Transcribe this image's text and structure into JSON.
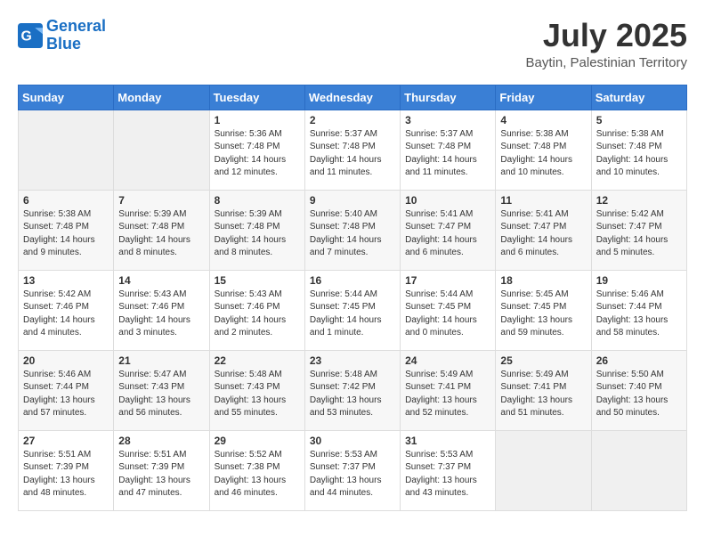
{
  "header": {
    "logo_line1": "General",
    "logo_line2": "Blue",
    "month_year": "July 2025",
    "location": "Baytin, Palestinian Territory"
  },
  "weekdays": [
    "Sunday",
    "Monday",
    "Tuesday",
    "Wednesday",
    "Thursday",
    "Friday",
    "Saturday"
  ],
  "weeks": [
    [
      {
        "day": "",
        "sunrise": "",
        "sunset": "",
        "daylight": ""
      },
      {
        "day": "",
        "sunrise": "",
        "sunset": "",
        "daylight": ""
      },
      {
        "day": "1",
        "sunrise": "Sunrise: 5:36 AM",
        "sunset": "Sunset: 7:48 PM",
        "daylight": "Daylight: 14 hours and 12 minutes."
      },
      {
        "day": "2",
        "sunrise": "Sunrise: 5:37 AM",
        "sunset": "Sunset: 7:48 PM",
        "daylight": "Daylight: 14 hours and 11 minutes."
      },
      {
        "day": "3",
        "sunrise": "Sunrise: 5:37 AM",
        "sunset": "Sunset: 7:48 PM",
        "daylight": "Daylight: 14 hours and 11 minutes."
      },
      {
        "day": "4",
        "sunrise": "Sunrise: 5:38 AM",
        "sunset": "Sunset: 7:48 PM",
        "daylight": "Daylight: 14 hours and 10 minutes."
      },
      {
        "day": "5",
        "sunrise": "Sunrise: 5:38 AM",
        "sunset": "Sunset: 7:48 PM",
        "daylight": "Daylight: 14 hours and 10 minutes."
      }
    ],
    [
      {
        "day": "6",
        "sunrise": "Sunrise: 5:38 AM",
        "sunset": "Sunset: 7:48 PM",
        "daylight": "Daylight: 14 hours and 9 minutes."
      },
      {
        "day": "7",
        "sunrise": "Sunrise: 5:39 AM",
        "sunset": "Sunset: 7:48 PM",
        "daylight": "Daylight: 14 hours and 8 minutes."
      },
      {
        "day": "8",
        "sunrise": "Sunrise: 5:39 AM",
        "sunset": "Sunset: 7:48 PM",
        "daylight": "Daylight: 14 hours and 8 minutes."
      },
      {
        "day": "9",
        "sunrise": "Sunrise: 5:40 AM",
        "sunset": "Sunset: 7:48 PM",
        "daylight": "Daylight: 14 hours and 7 minutes."
      },
      {
        "day": "10",
        "sunrise": "Sunrise: 5:41 AM",
        "sunset": "Sunset: 7:47 PM",
        "daylight": "Daylight: 14 hours and 6 minutes."
      },
      {
        "day": "11",
        "sunrise": "Sunrise: 5:41 AM",
        "sunset": "Sunset: 7:47 PM",
        "daylight": "Daylight: 14 hours and 6 minutes."
      },
      {
        "day": "12",
        "sunrise": "Sunrise: 5:42 AM",
        "sunset": "Sunset: 7:47 PM",
        "daylight": "Daylight: 14 hours and 5 minutes."
      }
    ],
    [
      {
        "day": "13",
        "sunrise": "Sunrise: 5:42 AM",
        "sunset": "Sunset: 7:46 PM",
        "daylight": "Daylight: 14 hours and 4 minutes."
      },
      {
        "day": "14",
        "sunrise": "Sunrise: 5:43 AM",
        "sunset": "Sunset: 7:46 PM",
        "daylight": "Daylight: 14 hours and 3 minutes."
      },
      {
        "day": "15",
        "sunrise": "Sunrise: 5:43 AM",
        "sunset": "Sunset: 7:46 PM",
        "daylight": "Daylight: 14 hours and 2 minutes."
      },
      {
        "day": "16",
        "sunrise": "Sunrise: 5:44 AM",
        "sunset": "Sunset: 7:45 PM",
        "daylight": "Daylight: 14 hours and 1 minute."
      },
      {
        "day": "17",
        "sunrise": "Sunrise: 5:44 AM",
        "sunset": "Sunset: 7:45 PM",
        "daylight": "Daylight: 14 hours and 0 minutes."
      },
      {
        "day": "18",
        "sunrise": "Sunrise: 5:45 AM",
        "sunset": "Sunset: 7:45 PM",
        "daylight": "Daylight: 13 hours and 59 minutes."
      },
      {
        "day": "19",
        "sunrise": "Sunrise: 5:46 AM",
        "sunset": "Sunset: 7:44 PM",
        "daylight": "Daylight: 13 hours and 58 minutes."
      }
    ],
    [
      {
        "day": "20",
        "sunrise": "Sunrise: 5:46 AM",
        "sunset": "Sunset: 7:44 PM",
        "daylight": "Daylight: 13 hours and 57 minutes."
      },
      {
        "day": "21",
        "sunrise": "Sunrise: 5:47 AM",
        "sunset": "Sunset: 7:43 PM",
        "daylight": "Daylight: 13 hours and 56 minutes."
      },
      {
        "day": "22",
        "sunrise": "Sunrise: 5:48 AM",
        "sunset": "Sunset: 7:43 PM",
        "daylight": "Daylight: 13 hours and 55 minutes."
      },
      {
        "day": "23",
        "sunrise": "Sunrise: 5:48 AM",
        "sunset": "Sunset: 7:42 PM",
        "daylight": "Daylight: 13 hours and 53 minutes."
      },
      {
        "day": "24",
        "sunrise": "Sunrise: 5:49 AM",
        "sunset": "Sunset: 7:41 PM",
        "daylight": "Daylight: 13 hours and 52 minutes."
      },
      {
        "day": "25",
        "sunrise": "Sunrise: 5:49 AM",
        "sunset": "Sunset: 7:41 PM",
        "daylight": "Daylight: 13 hours and 51 minutes."
      },
      {
        "day": "26",
        "sunrise": "Sunrise: 5:50 AM",
        "sunset": "Sunset: 7:40 PM",
        "daylight": "Daylight: 13 hours and 50 minutes."
      }
    ],
    [
      {
        "day": "27",
        "sunrise": "Sunrise: 5:51 AM",
        "sunset": "Sunset: 7:39 PM",
        "daylight": "Daylight: 13 hours and 48 minutes."
      },
      {
        "day": "28",
        "sunrise": "Sunrise: 5:51 AM",
        "sunset": "Sunset: 7:39 PM",
        "daylight": "Daylight: 13 hours and 47 minutes."
      },
      {
        "day": "29",
        "sunrise": "Sunrise: 5:52 AM",
        "sunset": "Sunset: 7:38 PM",
        "daylight": "Daylight: 13 hours and 46 minutes."
      },
      {
        "day": "30",
        "sunrise": "Sunrise: 5:53 AM",
        "sunset": "Sunset: 7:37 PM",
        "daylight": "Daylight: 13 hours and 44 minutes."
      },
      {
        "day": "31",
        "sunrise": "Sunrise: 5:53 AM",
        "sunset": "Sunset: 7:37 PM",
        "daylight": "Daylight: 13 hours and 43 minutes."
      },
      {
        "day": "",
        "sunrise": "",
        "sunset": "",
        "daylight": ""
      },
      {
        "day": "",
        "sunrise": "",
        "sunset": "",
        "daylight": ""
      }
    ]
  ]
}
